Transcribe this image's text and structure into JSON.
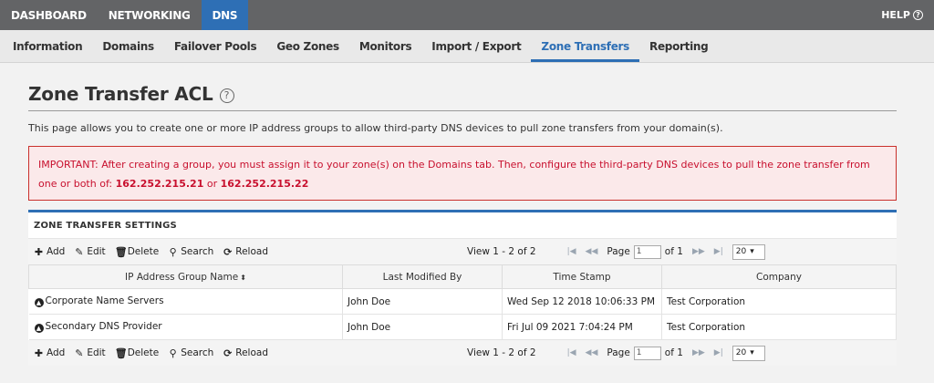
{
  "topnav": {
    "items": [
      "DASHBOARD",
      "NETWORKING",
      "DNS"
    ],
    "help_label": "HELP"
  },
  "subnav": {
    "tabs": [
      "Information",
      "Domains",
      "Failover Pools",
      "Geo Zones",
      "Monitors",
      "Import / Export",
      "Zone Transfers",
      "Reporting"
    ],
    "active": "Zone Transfers"
  },
  "page": {
    "title": "Zone Transfer ACL",
    "description": "This page allows you to create one or more IP address groups to allow third-party DNS devices to pull zone transfers from your domain(s).",
    "alert_text": "IMPORTANT: After creating a group, you must assign it to your zone(s) on the Domains tab. Then, configure the third-party DNS devices to pull the zone transfer from one or both of:",
    "alert_ip1": "162.252.215.21",
    "alert_or": "or",
    "alert_ip2": "162.252.215.22"
  },
  "grid": {
    "title": "ZONE TRANSFER SETTINGS",
    "toolbar": {
      "add": "Add",
      "edit": "Edit",
      "delete": "Delete",
      "search": "Search",
      "reload": "Reload"
    },
    "pager": {
      "view": "View 1 - 2 of 2",
      "page_label": "Page",
      "page_value": "1",
      "of": "of 1",
      "rows_per_page": "20"
    },
    "columns": [
      "IP Address Group Name",
      "Last Modified By",
      "Time Stamp",
      "Company"
    ],
    "rows": [
      {
        "name": "Corporate Name Servers",
        "modified_by": "John Doe",
        "timestamp": "Wed Sep 12 2018 10:06:33 PM",
        "company": "Test Corporation"
      },
      {
        "name": "Secondary DNS Provider",
        "modified_by": "John Doe",
        "timestamp": "Fri Jul 09 2021 7:04:24 PM",
        "company": "Test Corporation"
      }
    ]
  },
  "colors": {
    "topnav_bg": "#636466",
    "accent": "#2e6fb5",
    "alert_text": "#c8102e",
    "alert_bg": "#fbe9ea"
  }
}
